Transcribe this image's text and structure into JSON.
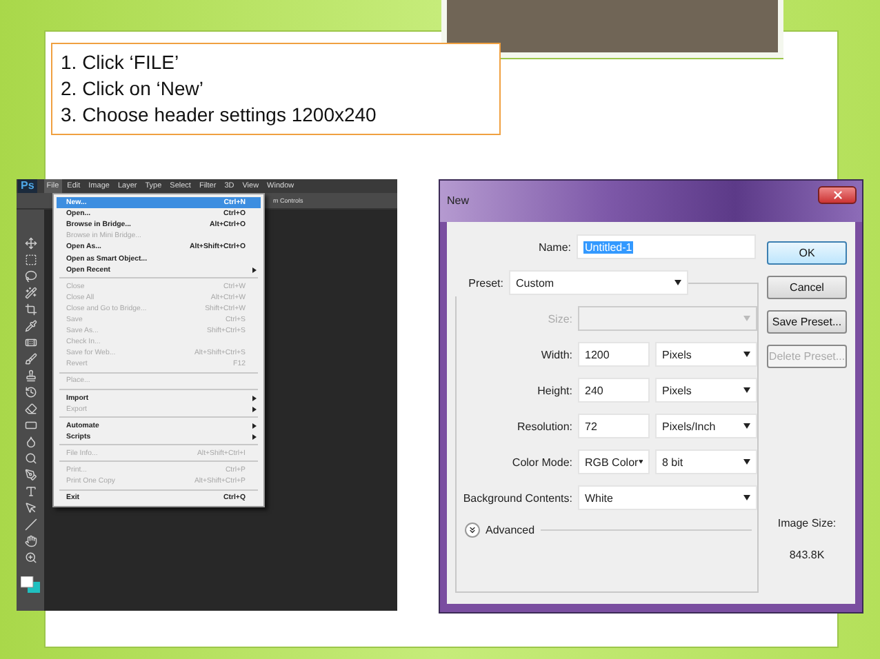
{
  "instructions": [
    "1. Click ‘FILE’",
    "2. Click on ‘New’",
    "3. Choose header settings 1200x240"
  ],
  "photoshop": {
    "logo": "Ps",
    "menu_bar": [
      {
        "label": "File",
        "selected": true
      },
      {
        "label": "Edit",
        "selected": false
      },
      {
        "label": "Image",
        "selected": false
      },
      {
        "label": "Layer",
        "selected": false
      },
      {
        "label": "Type",
        "selected": false
      },
      {
        "label": "Select",
        "selected": false
      },
      {
        "label": "Filter",
        "selected": false
      },
      {
        "label": "3D",
        "selected": false
      },
      {
        "label": "View",
        "selected": false
      },
      {
        "label": "Window",
        "selected": false
      }
    ],
    "options_bar_text": "m Controls",
    "file_menu": [
      {
        "kind": "item",
        "label": "New...",
        "shortcut": "Ctrl+N",
        "highlighted": true,
        "disabled": false,
        "submenu": false
      },
      {
        "kind": "item",
        "label": "Open...",
        "shortcut": "Ctrl+O",
        "highlighted": false,
        "disabled": false,
        "submenu": false
      },
      {
        "kind": "item",
        "label": "Browse in Bridge...",
        "shortcut": "Alt+Ctrl+O",
        "highlighted": false,
        "disabled": false,
        "submenu": false
      },
      {
        "kind": "item",
        "label": "Browse in Mini Bridge...",
        "highlighted": false,
        "disabled": true,
        "submenu": false
      },
      {
        "kind": "item",
        "label": "Open As...",
        "shortcut": "Alt+Shift+Ctrl+O",
        "highlighted": false,
        "disabled": false,
        "submenu": false
      },
      {
        "kind": "item",
        "label": "Open as Smart Object...",
        "highlighted": false,
        "disabled": false,
        "submenu": false
      },
      {
        "kind": "item",
        "label": "Open Recent",
        "highlighted": false,
        "disabled": false,
        "submenu": true
      },
      {
        "kind": "separator"
      },
      {
        "kind": "item",
        "label": "Close",
        "shortcut": "Ctrl+W",
        "highlighted": false,
        "disabled": true,
        "submenu": false
      },
      {
        "kind": "item",
        "label": "Close All",
        "shortcut": "Alt+Ctrl+W",
        "highlighted": false,
        "disabled": true,
        "submenu": false
      },
      {
        "kind": "item",
        "label": "Close and Go to Bridge...",
        "shortcut": "Shift+Ctrl+W",
        "highlighted": false,
        "disabled": true,
        "submenu": false
      },
      {
        "kind": "item",
        "label": "Save",
        "shortcut": "Ctrl+S",
        "highlighted": false,
        "disabled": true,
        "submenu": false
      },
      {
        "kind": "item",
        "label": "Save As...",
        "shortcut": "Shift+Ctrl+S",
        "highlighted": false,
        "disabled": true,
        "submenu": false
      },
      {
        "kind": "item",
        "label": "Check In...",
        "highlighted": false,
        "disabled": true,
        "submenu": false
      },
      {
        "kind": "item",
        "label": "Save for Web...",
        "shortcut": "Alt+Shift+Ctrl+S",
        "highlighted": false,
        "disabled": true,
        "submenu": false
      },
      {
        "kind": "item",
        "label": "Revert",
        "shortcut": "F12",
        "highlighted": false,
        "disabled": true,
        "submenu": false
      },
      {
        "kind": "separator"
      },
      {
        "kind": "item",
        "label": "Place...",
        "highlighted": false,
        "disabled": true,
        "submenu": false
      },
      {
        "kind": "separator"
      },
      {
        "kind": "item",
        "label": "Import",
        "highlighted": false,
        "disabled": false,
        "submenu": true
      },
      {
        "kind": "item",
        "label": "Export",
        "highlighted": false,
        "disabled": true,
        "submenu": true
      },
      {
        "kind": "separator"
      },
      {
        "kind": "item",
        "label": "Automate",
        "highlighted": false,
        "disabled": false,
        "submenu": true
      },
      {
        "kind": "item",
        "label": "Scripts",
        "highlighted": false,
        "disabled": false,
        "submenu": true
      },
      {
        "kind": "separator"
      },
      {
        "kind": "item",
        "label": "File Info...",
        "shortcut": "Alt+Shift+Ctrl+I",
        "highlighted": false,
        "disabled": true,
        "submenu": false
      },
      {
        "kind": "separator"
      },
      {
        "kind": "item",
        "label": "Print...",
        "shortcut": "Ctrl+P",
        "highlighted": false,
        "disabled": true,
        "submenu": false
      },
      {
        "kind": "item",
        "label": "Print One Copy",
        "shortcut": "Alt+Shift+Ctrl+P",
        "highlighted": false,
        "disabled": true,
        "submenu": false
      },
      {
        "kind": "separator"
      },
      {
        "kind": "item",
        "label": "Exit",
        "shortcut": "Ctrl+Q",
        "highlighted": false,
        "disabled": false,
        "submenu": false
      }
    ]
  },
  "new_dialog": {
    "title": "New",
    "name": {
      "label": "Name:",
      "value": "Untitled-1",
      "text_selected": true
    },
    "preset": {
      "label": "Preset:",
      "value": "Custom"
    },
    "rows": [
      {
        "kind": "wide_select",
        "label": "Size:",
        "disabled": true
      },
      {
        "kind": "value_unit",
        "label": "Width:",
        "value": "1200",
        "unit": "Pixels"
      },
      {
        "kind": "value_unit",
        "label": "Height:",
        "value": "240",
        "unit": "Pixels"
      },
      {
        "kind": "value_unit",
        "label": "Resolution:",
        "value": "72",
        "unit": "Pixels/Inch"
      },
      {
        "kind": "select_pair",
        "label": "Color Mode:",
        "value": "RGB Color",
        "depth": "8 bit"
      },
      {
        "kind": "wide_select",
        "label": "Background Contents:",
        "value": "White",
        "disabled": false
      }
    ],
    "advanced": {
      "label": "Advanced",
      "expanded": false
    },
    "buttons": [
      {
        "label": "OK",
        "default": true,
        "disabled": false
      },
      {
        "label": "Cancel",
        "default": false,
        "disabled": false
      },
      {
        "label": "Save Preset...",
        "default": false,
        "disabled": false
      },
      {
        "label": "Delete Preset...",
        "default": false,
        "disabled": true
      }
    ],
    "image_size": {
      "label": "Image Size:",
      "value": "843.8K"
    }
  }
}
